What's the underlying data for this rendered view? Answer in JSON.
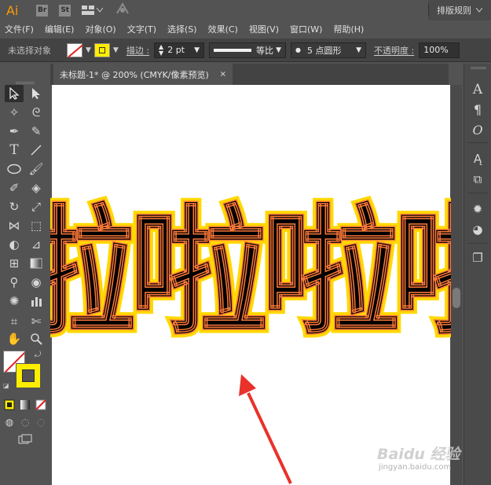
{
  "app": {
    "logo": "Ai",
    "br_label": "Br",
    "st_label": "St",
    "workspace_label": "排版规则"
  },
  "menu": {
    "items": [
      "文件(F)",
      "编辑(E)",
      "对象(O)",
      "文字(T)",
      "选择(S)",
      "效果(C)",
      "视图(V)",
      "窗口(W)",
      "帮助(H)"
    ]
  },
  "control": {
    "selection_status": "未选择对象",
    "stroke_label": "描边 :",
    "stroke_weight": "2 pt",
    "stroke_profile": "等比",
    "brush_label": "5 点圆形",
    "opacity_label": "不透明度 :",
    "opacity_value": "100%"
  },
  "document": {
    "tab_title": "未标题-1* @ 200% (CMYK/像素预览)",
    "close_symbol": "×"
  },
  "canvas": {
    "art_text": "啦啦啦啦"
  },
  "watermark": {
    "main": "Baidu 经验",
    "sub": "jingyan.baidu.com"
  },
  "colors": {
    "fill": "#000000",
    "stroke_outer": "#ffd800",
    "stroke_inner": "#ff8a4a",
    "accent_logo": "#ff9a00",
    "arrow": "#e8322a"
  },
  "icons": {
    "tools": [
      "selection-icon",
      "direct-selection-icon",
      "magic-wand-icon",
      "lasso-icon",
      "pen-icon",
      "curvature-icon",
      "type-icon",
      "line-icon",
      "ellipse-icon",
      "paintbrush-icon",
      "shaper-icon",
      "eraser-icon",
      "rotate-icon",
      "scale-icon",
      "width-icon",
      "free-transform-icon",
      "shape-builder-icon",
      "perspective-icon",
      "mesh-icon",
      "gradient-icon",
      "eyedropper-icon",
      "blend-icon",
      "symbol-sprayer-icon",
      "column-graph-icon",
      "artboard-icon",
      "slice-icon",
      "hand-icon",
      "zoom-icon"
    ],
    "panels": [
      "character-icon",
      "paragraph-icon",
      "opentype-icon",
      "transparency-icon",
      "appearance-icon",
      "graphic-styles-icon",
      "layers-icon",
      "artboards-icon"
    ]
  }
}
